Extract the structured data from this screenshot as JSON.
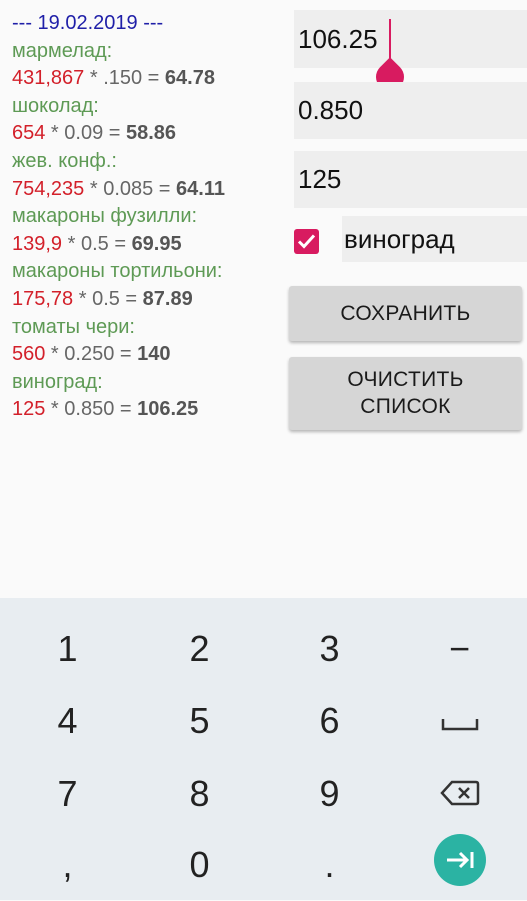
{
  "list": {
    "date_line": "--- 19.02.2019 ---",
    "items": [
      {
        "name": "мармелад:",
        "qty": "431,867",
        "op": " * .150 = ",
        "result": "64.78"
      },
      {
        "name": "шоколад:",
        "qty": "654",
        "op": " * 0.09 = ",
        "result": "58.86"
      },
      {
        "name": "жев. конф.:",
        "qty": "754,235",
        "op": " * 0.085 = ",
        "result": "64.11"
      },
      {
        "name": "макароны фузилли:",
        "qty": "139,9",
        "op": " * 0.5 = ",
        "result": "69.95"
      },
      {
        "name": "макароны тортильони:",
        "qty": "175,78",
        "op": " * 0.5 = ",
        "result": "87.89"
      },
      {
        "name": "томаты чери:",
        "qty": "560",
        "op": " * 0.250 = ",
        "result": "140"
      },
      {
        "name": "виноград:",
        "qty": "125",
        "op": " * 0.850 = ",
        "result": "106.25"
      }
    ]
  },
  "form": {
    "total_value": "106.25",
    "coef_value": "0.850",
    "qty_value": "125",
    "checkbox_checked": true,
    "product_value": "виноград",
    "save_label": "СОХРАНИТЬ",
    "clear_label_line1": "ОЧИСТИТЬ",
    "clear_label_line2": "СПИСОК"
  },
  "keyboard": {
    "rows": [
      [
        "1",
        "2",
        "3",
        "−"
      ],
      [
        "4",
        "5",
        "6",
        "space"
      ],
      [
        "7",
        "8",
        "9",
        "backspace"
      ],
      [
        ",",
        "0",
        ".",
        "enter"
      ]
    ]
  },
  "colors": {
    "accent": "#d81b60",
    "date": "#1f1fa8",
    "name": "#5e9a55",
    "qty": "#d3202a",
    "enter": "#2bb3a3"
  }
}
